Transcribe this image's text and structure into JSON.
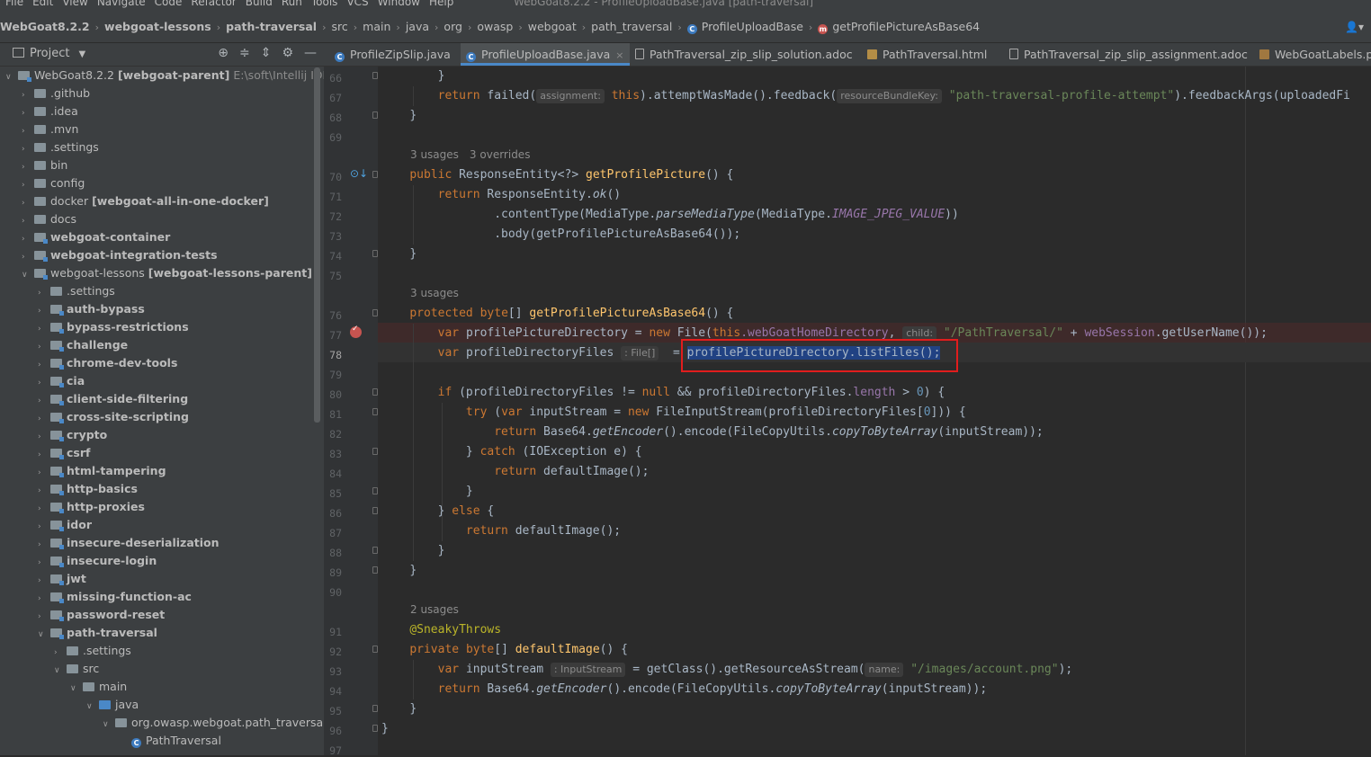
{
  "menubar": {
    "items": [
      "File",
      "Edit",
      "View",
      "Navigate",
      "Code",
      "Refactor",
      "Build",
      "Run",
      "Tools",
      "VCS",
      "Window",
      "Help"
    ],
    "window_title": "WebGoat8.2.2 - ProfileUploadBase.java [path-traversal]"
  },
  "breadcrumbs": {
    "items": [
      "WebGoat8.2.2",
      "webgoat-lessons",
      "path-traversal",
      "src",
      "main",
      "java",
      "org",
      "owasp",
      "webgoat",
      "path_traversal",
      "ProfileUploadBase",
      "getProfilePictureAsBase64"
    ],
    "class_icon": "C",
    "method_icon": "m"
  },
  "project_panel": {
    "title": "Project",
    "tree": [
      {
        "name": "WebGoat8.2.2",
        "extra": "[webgoat-parent]",
        "hint": "E:\\soft\\Intellij IDEA\\",
        "level": 0,
        "expanded": true,
        "icon": "folder-mod",
        "bold": false
      },
      {
        "name": ".github",
        "level": 1,
        "expanded": false,
        "icon": "folder",
        "bold": false
      },
      {
        "name": ".idea",
        "level": 1,
        "expanded": false,
        "icon": "folder",
        "bold": false
      },
      {
        "name": ".mvn",
        "level": 1,
        "expanded": false,
        "icon": "folder",
        "bold": false
      },
      {
        "name": ".settings",
        "level": 1,
        "expanded": false,
        "icon": "folder",
        "bold": false
      },
      {
        "name": "bin",
        "level": 1,
        "expanded": false,
        "icon": "folder",
        "bold": false
      },
      {
        "name": "config",
        "level": 1,
        "expanded": false,
        "icon": "folder",
        "bold": false
      },
      {
        "name": "docker",
        "extra": "[webgoat-all-in-one-docker]",
        "level": 1,
        "expanded": false,
        "icon": "folder",
        "bold": false
      },
      {
        "name": "docs",
        "level": 1,
        "expanded": false,
        "icon": "folder",
        "bold": false
      },
      {
        "name": "webgoat-container",
        "level": 1,
        "expanded": false,
        "icon": "folder-mod",
        "bold": true
      },
      {
        "name": "webgoat-integration-tests",
        "level": 1,
        "expanded": false,
        "icon": "folder-mod",
        "bold": true
      },
      {
        "name": "webgoat-lessons",
        "extra": "[webgoat-lessons-parent]",
        "level": 1,
        "expanded": true,
        "icon": "folder-mod",
        "bold": false
      },
      {
        "name": ".settings",
        "level": 2,
        "expanded": false,
        "icon": "folder",
        "bold": false
      },
      {
        "name": "auth-bypass",
        "level": 2,
        "expanded": false,
        "icon": "folder-mod",
        "bold": true
      },
      {
        "name": "bypass-restrictions",
        "level": 2,
        "expanded": false,
        "icon": "folder-mod",
        "bold": true
      },
      {
        "name": "challenge",
        "level": 2,
        "expanded": false,
        "icon": "folder-mod",
        "bold": true
      },
      {
        "name": "chrome-dev-tools",
        "level": 2,
        "expanded": false,
        "icon": "folder-mod",
        "bold": true
      },
      {
        "name": "cia",
        "level": 2,
        "expanded": false,
        "icon": "folder-mod",
        "bold": true
      },
      {
        "name": "client-side-filtering",
        "level": 2,
        "expanded": false,
        "icon": "folder-mod",
        "bold": true
      },
      {
        "name": "cross-site-scripting",
        "level": 2,
        "expanded": false,
        "icon": "folder-mod",
        "bold": true
      },
      {
        "name": "crypto",
        "level": 2,
        "expanded": false,
        "icon": "folder-mod",
        "bold": true
      },
      {
        "name": "csrf",
        "level": 2,
        "expanded": false,
        "icon": "folder-mod",
        "bold": true
      },
      {
        "name": "html-tampering",
        "level": 2,
        "expanded": false,
        "icon": "folder-mod",
        "bold": true
      },
      {
        "name": "http-basics",
        "level": 2,
        "expanded": false,
        "icon": "folder-mod",
        "bold": true
      },
      {
        "name": "http-proxies",
        "level": 2,
        "expanded": false,
        "icon": "folder-mod",
        "bold": true
      },
      {
        "name": "idor",
        "level": 2,
        "expanded": false,
        "icon": "folder-mod",
        "bold": true
      },
      {
        "name": "insecure-deserialization",
        "level": 2,
        "expanded": false,
        "icon": "folder-mod",
        "bold": true
      },
      {
        "name": "insecure-login",
        "level": 2,
        "expanded": false,
        "icon": "folder-mod",
        "bold": true
      },
      {
        "name": "jwt",
        "level": 2,
        "expanded": false,
        "icon": "folder-mod",
        "bold": true
      },
      {
        "name": "missing-function-ac",
        "level": 2,
        "expanded": false,
        "icon": "folder-mod",
        "bold": true
      },
      {
        "name": "password-reset",
        "level": 2,
        "expanded": false,
        "icon": "folder-mod",
        "bold": true
      },
      {
        "name": "path-traversal",
        "level": 2,
        "expanded": true,
        "icon": "folder-mod",
        "bold": true
      },
      {
        "name": ".settings",
        "level": 3,
        "expanded": false,
        "icon": "folder",
        "bold": false
      },
      {
        "name": "src",
        "level": 3,
        "expanded": true,
        "icon": "folder",
        "bold": false
      },
      {
        "name": "main",
        "level": 4,
        "expanded": true,
        "icon": "folder",
        "bold": false
      },
      {
        "name": "java",
        "level": 5,
        "expanded": true,
        "icon": "folder-blue",
        "bold": false
      },
      {
        "name": "org.owasp.webgoat.path_traversal",
        "level": 6,
        "expanded": true,
        "icon": "folder",
        "bold": false
      },
      {
        "name": "PathTraversal",
        "level": 7,
        "expanded": null,
        "icon": "class",
        "bold": false
      }
    ]
  },
  "tabs": [
    {
      "label": "ProfileZipSlip.java",
      "icon": "C",
      "active": false
    },
    {
      "label": "ProfileUploadBase.java",
      "icon": "C",
      "active": true
    },
    {
      "label": "PathTraversal_zip_slip_solution.adoc",
      "icon": "doc",
      "active": false
    },
    {
      "label": "PathTraversal.html",
      "icon": "html",
      "active": false
    },
    {
      "label": "PathTraversal_zip_slip_assignment.adoc",
      "icon": "doc",
      "active": false
    },
    {
      "label": "WebGoatLabels.pr",
      "icon": "lbl",
      "active": false
    }
  ],
  "tab_close": "×",
  "editor": {
    "line_numbers": [
      "66",
      "67",
      "68",
      "69",
      "70",
      "71",
      "72",
      "73",
      "74",
      "75",
      "76",
      "77",
      "78",
      "79",
      "80",
      "81",
      "82",
      "83",
      "84",
      "85",
      "86",
      "87",
      "88",
      "89",
      "90",
      "91",
      "92",
      "93",
      "94",
      "95",
      "96",
      "97"
    ],
    "current_line": "78",
    "breakpoint_line": "77",
    "hints": {
      "usages_getProfilePicture": "3 usages",
      "overrides_getProfilePicture": "3 overrides",
      "usages_getProfilePictureAsBase64": "3 usages",
      "usages_defaultImage": "2 usages"
    },
    "params": {
      "assignment": "assignment:",
      "resourceBundleKey": "resourceBundleKey:",
      "child": "child:",
      "file_type": ": File[]",
      "inputstream_type": ": InputStream",
      "name": "name:"
    },
    "code": {
      "l66": "}",
      "l67_return": "return",
      "l67_failed": "failed(",
      "l67_this": "this",
      "l67_mid": ").attemptWasMade().feedback(",
      "l67_str": "\"path-traversal-profile-attempt\"",
      "l67_end": ").feedbackArgs(uploadedFi",
      "l68": "}",
      "l70_public": "public",
      "l70_type": "ResponseEntity<?>",
      "l70_fn": "getProfilePicture",
      "l70_end": "() {",
      "l71_return": "return",
      "l71_a": "ResponseEntity.",
      "l71_ok": "ok",
      "l71_end": "()",
      "l72_a": ".contentType(MediaType.",
      "l72_parse": "parseMediaType",
      "l72_b": "(MediaType.",
      "l72_const": "IMAGE_JPEG_VALUE",
      "l72_end": "))",
      "l73": ".body(getProfilePictureAsBase64());",
      "l74": "}",
      "l76_protected": "protected",
      "l76_byte": "byte",
      "l76_arr": "[]",
      "l76_fn": "getProfilePictureAsBase64",
      "l76_end": "() {",
      "l77_var": "var",
      "l77_a": "profilePictureDirectory =",
      "l77_new": "new",
      "l77_b": "File(",
      "l77_this": "this",
      "l77_fld": ".webGoatHomeDirectory",
      "l77_comma": ",",
      "l77_str": "\"/PathTraversal/\"",
      "l77_plus": "+",
      "l77_ws": "webSession",
      "l77_end": ".getUserName());",
      "l78_var": "var",
      "l78_a": "profileDirectoryFiles",
      "l78_eq": "=",
      "l78_sel": "profilePictureDirectory.listFiles();",
      "l80_if": "if",
      "l80_a": "(profileDirectoryFiles !=",
      "l80_null": "null",
      "l80_b": "&& profileDirectoryFiles.",
      "l80_len": "length",
      "l80_c": "> ",
      "l80_zero": "0",
      "l80_end": ") {",
      "l81_try": "try",
      "l81_a": "(",
      "l81_var": "var",
      "l81_b": "inputStream =",
      "l81_new": "new",
      "l81_c": "FileInputStream(profileDirectoryFiles[",
      "l81_zero": "0",
      "l81_end": "])) {",
      "l82_return": "return",
      "l82_a": "Base64.",
      "l82_enc": "getEncoder",
      "l82_b": "().encode(FileCopyUtils.",
      "l82_copy": "copyToByteArray",
      "l82_end": "(inputStream));",
      "l83_a": "} ",
      "l83_catch": "catch",
      "l83_end": "(IOException e) {",
      "l84_return": "return",
      "l84_end": "defaultImage();",
      "l85": "}",
      "l86_a": "} ",
      "l86_else": "else",
      "l86_end": "{",
      "l87_return": "return",
      "l87_end": "defaultImage();",
      "l88": "}",
      "l89": "}",
      "l91": "@SneakyThrows",
      "l92_private": "private",
      "l92_byte": "byte",
      "l92_arr": "[]",
      "l92_fn": "defaultImage",
      "l92_end": "() {",
      "l93_var": "var",
      "l93_a": "inputStream",
      "l93_b": "= getClass().getResourceAsStream(",
      "l93_str": "\"/images/account.png\"",
      "l93_end": ");",
      "l94_return": "return",
      "l94_a": "Base64.",
      "l94_enc": "getEncoder",
      "l94_b": "().encode(FileCopyUtils.",
      "l94_copy": "copyToByteArray",
      "l94_end": "(inputStream));",
      "l95": "}",
      "l96": "}"
    }
  },
  "colors": {
    "keyword": "#cc7832",
    "function": "#ffc66d",
    "string": "#6a8759",
    "number": "#6897bb",
    "field": "#9876aa",
    "selection": "#214283",
    "annotation_box": "#e11d1d"
  }
}
